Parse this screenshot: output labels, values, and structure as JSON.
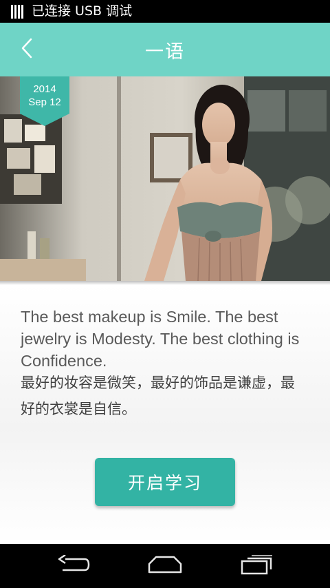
{
  "status_bar": {
    "text": "已连接 USB 调试",
    "icon": "usb-debug-icon"
  },
  "header": {
    "title": "一语",
    "back_icon": "chevron-left-icon",
    "color": "#6fd4c6"
  },
  "hero": {
    "date_year": "2014",
    "date_day": "Sep 12",
    "speaker_icon": "speaker-icon"
  },
  "quote": {
    "english": "The best makeup is Smile. The best jewelry is Modesty. The best clothing is Confidence.",
    "chinese": "最好的妆容是微笑，最好的饰品是谦虚，最好的衣裳是自信。"
  },
  "action": {
    "start_label": "开启学习",
    "color": "#33b3a4"
  },
  "nav_bar": {
    "back_icon": "nav-back-icon",
    "home_icon": "nav-home-icon",
    "recents_icon": "nav-recents-icon"
  }
}
